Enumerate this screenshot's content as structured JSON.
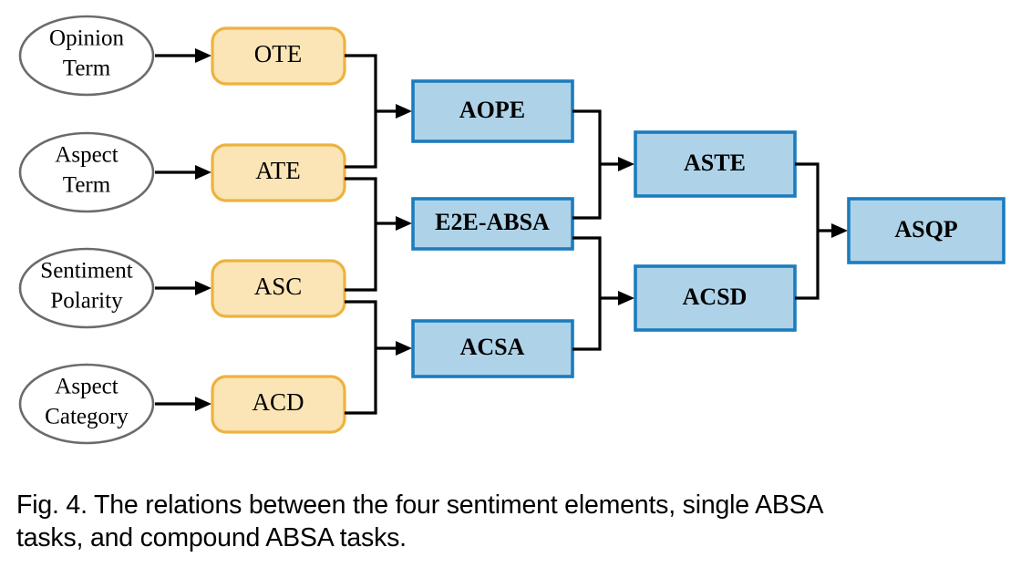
{
  "figure": {
    "caption": "Fig. 4. The relations between the four sentiment elements, single ABSA\ntasks, and compound ABSA tasks."
  },
  "colors": {
    "element_ellipse_fill": "#ffffff",
    "element_ellipse_stroke": "#6b6b6b",
    "single_task_fill": "#fbe5b6",
    "single_task_stroke": "#edb23f",
    "compound_task_fill": "#aed3e9",
    "compound_task_stroke": "#1c7cbd",
    "connector": "#000000",
    "background": "#ffffff"
  },
  "sentiment_elements": [
    {
      "id": "opinion-term",
      "line1": "Opinion",
      "line2": "Term"
    },
    {
      "id": "aspect-term",
      "line1": "Aspect",
      "line2": "Term"
    },
    {
      "id": "sentiment-polarity",
      "line1": "Sentiment",
      "line2": "Polarity"
    },
    {
      "id": "aspect-category",
      "line1": "Aspect",
      "line2": "Category"
    }
  ],
  "single_tasks": [
    {
      "id": "ote",
      "label": "OTE"
    },
    {
      "id": "ate",
      "label": "ATE"
    },
    {
      "id": "asc",
      "label": "ASC"
    },
    {
      "id": "acd",
      "label": "ACD"
    }
  ],
  "compound_tasks_level1": [
    {
      "id": "aope",
      "label": "AOPE"
    },
    {
      "id": "e2e-absa",
      "label": "E2E-ABSA"
    },
    {
      "id": "acsa",
      "label": "ACSA"
    }
  ],
  "compound_tasks_level2": [
    {
      "id": "aste",
      "label": "ASTE"
    },
    {
      "id": "acsd",
      "label": "ACSD"
    }
  ],
  "compound_tasks_level3": [
    {
      "id": "asqp",
      "label": "ASQP"
    }
  ]
}
